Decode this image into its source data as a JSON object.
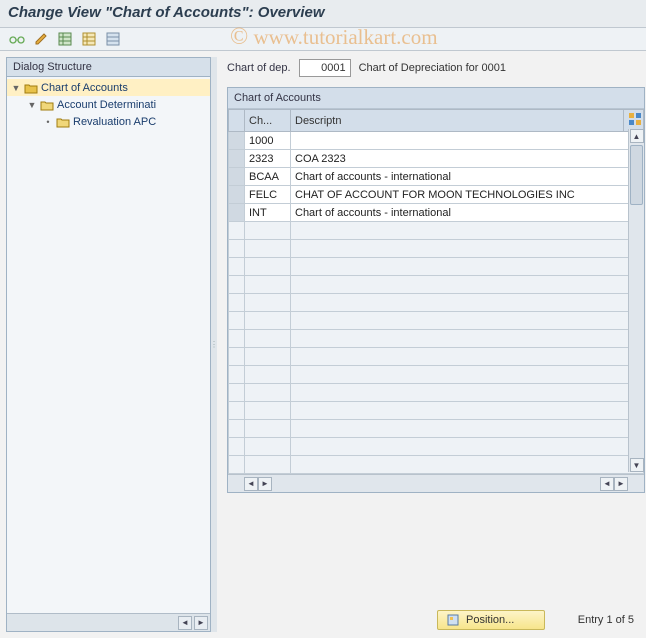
{
  "title": "Change View \"Chart of Accounts\": Overview",
  "watermark": "© www.tutorialkart.com",
  "toolbar": {
    "items": [
      "glasses-icon",
      "pencil-icon",
      "grid-new-icon",
      "grid-open-icon",
      "grid-list-icon"
    ]
  },
  "dialog_structure": {
    "header": "Dialog Structure",
    "nodes": [
      {
        "label": "Chart of Accounts",
        "level": 0,
        "expanded": true,
        "open": true,
        "selected": true
      },
      {
        "label": "Account Determinati",
        "level": 1,
        "expanded": true,
        "open": false,
        "selected": false
      },
      {
        "label": "Revaluation APC",
        "level": 2,
        "expanded": false,
        "open": false,
        "selected": false
      }
    ]
  },
  "field": {
    "label": "Chart of dep.",
    "value": "0001",
    "desc": "Chart of Depreciation for 0001"
  },
  "group": {
    "title": "Chart of Accounts",
    "columns": {
      "ch": "Ch...",
      "desc": "Descriptn"
    },
    "rows": [
      {
        "ch": "1000",
        "desc": ""
      },
      {
        "ch": "2323",
        "desc": "COA 2323"
      },
      {
        "ch": "BCAA",
        "desc": "Chart of accounts - international"
      },
      {
        "ch": "FELC",
        "desc": "CHAT OF ACCOUNT FOR MOON TECHNOLOGIES INC"
      },
      {
        "ch": "INT",
        "desc": "Chart of accounts - international"
      }
    ],
    "empty_rows": 14
  },
  "footer": {
    "position_label": "Position...",
    "entry_text": "Entry 1 of 5"
  }
}
